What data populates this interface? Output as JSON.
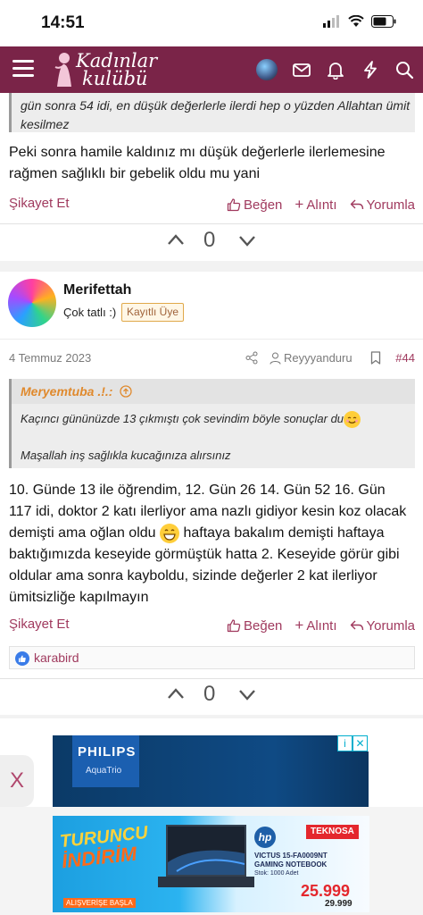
{
  "status_bar": {
    "time": "14:51"
  },
  "nav": {
    "logo_line1": "Kadınlar",
    "logo_line2": "kulübü"
  },
  "quote_top": {
    "text": "gün sonra 54 idi, en düşük değerlerle ilerdi hep o yüzden Allahtan ümit kesilmez"
  },
  "post1": {
    "text": "Peki sonra hamile kaldınız mı düşük değerlerle ilerlemesine rağmen sağlıklı bir gebelik oldu mu yani",
    "report": "Şikayet Et",
    "like": "Beğen",
    "quote": "Alıntı",
    "reply": "Yorumla",
    "vote_count": "0"
  },
  "post2": {
    "username": "Merifettah",
    "user_title": "Çok tatlı :)",
    "badge": "Kayıtlı Üye",
    "date": "4 Temmuz 2023",
    "author_link": "Reyyyanduru",
    "post_number": "#44",
    "quote_author": "Meryemtuba .!.:",
    "quote_line1": "Kaçıncı gününüzde 13 çıkmıştı çok sevindim böyle sonuçlar du",
    "quote_line2": "Maşallah inş sağlıkla kucağınıza alırsınız",
    "text_part1": "10. Günde 13 ile öğrendim, 12. Gün 26 14. Gün 52 16. Gün 117 idi, doktor 2 katı ilerliyor ama nazlı gidiyor kesin koz olacak demişti ama oğlan oldu",
    "text_part2": "haftaya bakalım demişti haftaya baktığımızda keseyide görmüştük hatta 2. Keseyide görür gibi oldular ama sonra kayboldu, sizinde değerler 2 kat ilerliyor ümitsizliğe kapılmayın",
    "report": "Şikayet Et",
    "like": "Beğen",
    "quote": "Alıntı",
    "reply": "Yorumla",
    "liked_by": "karabird",
    "vote_count": "0"
  },
  "ads": {
    "close_tab": "X",
    "philips_brand": "PHILIPS",
    "philips_product": "AquaTrio",
    "tekno_headline1": "TURUNCU",
    "tekno_headline2": "İNDİRİM",
    "tekno_cta": "ALIŞVERİŞE BAŞLA",
    "hp": "hp",
    "teknosa": "TEKNOSA",
    "product_line1": "VICTUS 15-FA0009NT",
    "product_line2": "GAMING NOTEBOOK",
    "stock": "Stok: 1000 Adet",
    "price": "25.999",
    "price_old": "29.999"
  },
  "colors": {
    "brand": "#7a2448",
    "link": "#a03a5e",
    "quote_author": "#e08a2e"
  }
}
